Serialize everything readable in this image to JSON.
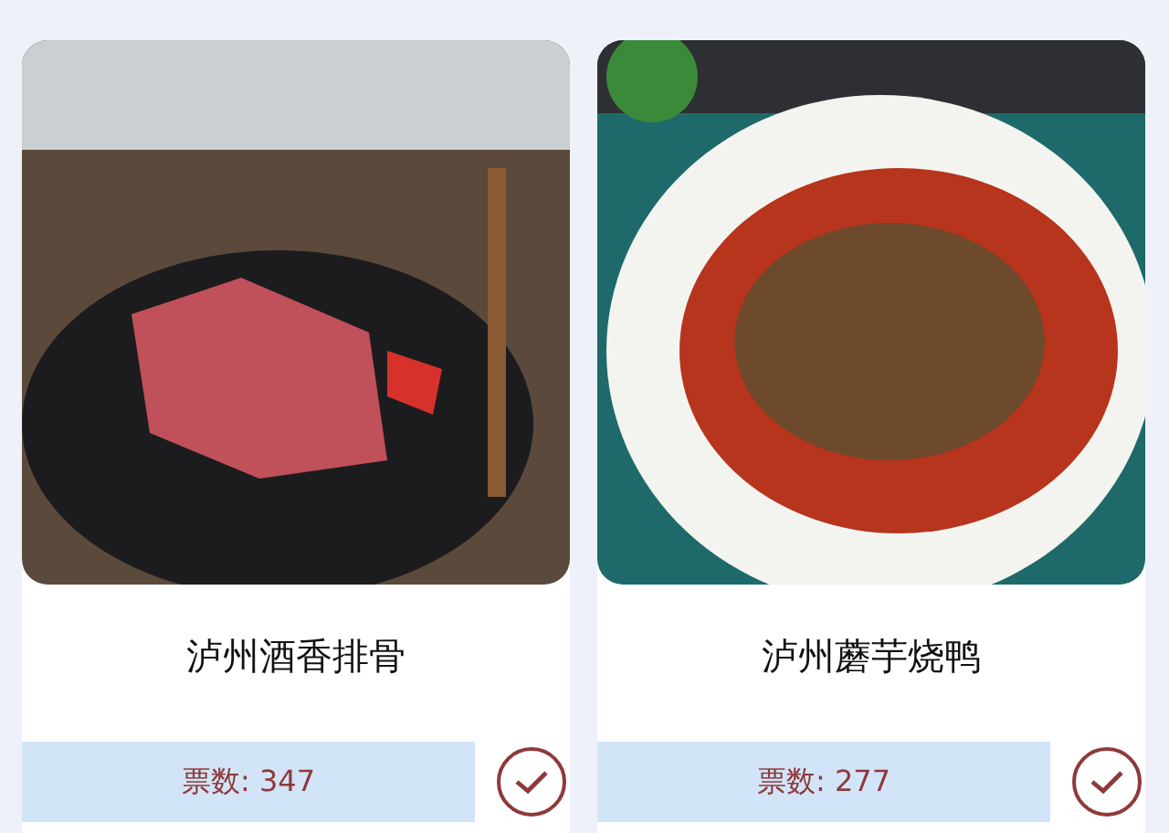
{
  "dishes": [
    {
      "name": "泸州酒香排骨",
      "votes": "票数: 347",
      "kind": "ribs"
    },
    {
      "name": "泸州蘑芋烧鸭",
      "votes": "票数: 277",
      "kind": "duck"
    }
  ]
}
